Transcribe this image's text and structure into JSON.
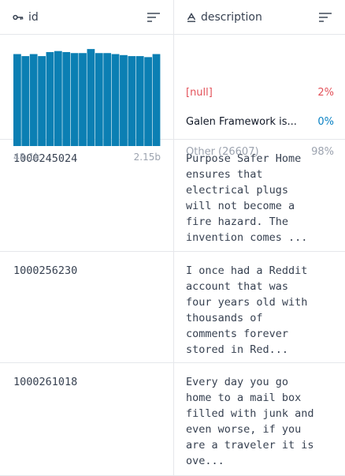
{
  "columns": {
    "id": {
      "title": "id",
      "type_icon": "key-icon"
    },
    "description": {
      "title": "description",
      "type_icon": "string-type-icon"
    }
  },
  "id_summary": {
    "min_label": "48.1k",
    "max_label": "2.15b",
    "bar_color": "#0b7fb3",
    "bins": [
      0.91,
      0.89,
      0.91,
      0.89,
      0.93,
      0.94,
      0.93,
      0.92,
      0.92,
      0.96,
      0.92,
      0.92,
      0.91,
      0.9,
      0.89,
      0.89,
      0.88,
      0.91
    ]
  },
  "description_summary": {
    "categories": [
      {
        "label": "[null]",
        "pct": "2%"
      },
      {
        "label": "Galen Framework is...",
        "pct": "0%"
      },
      {
        "label": "Other (26607)",
        "pct": "98%"
      }
    ]
  },
  "rows": [
    {
      "id": "1000245024",
      "description": "Purpose Safer Home\nensures that\nelectrical plugs\nwill not become a\nfire hazard. The\ninvention comes ..."
    },
    {
      "id": "1000256230",
      "description": "I once had a Reddit\naccount that was\nfour years old with\nthousands of\ncomments forever\nstored in Red..."
    },
    {
      "id": "1000261018",
      "description": "Every day you go\nhome to a mail box\nfilled with junk and\neven worse, if you\nare a traveler it is\nove..."
    }
  ]
}
